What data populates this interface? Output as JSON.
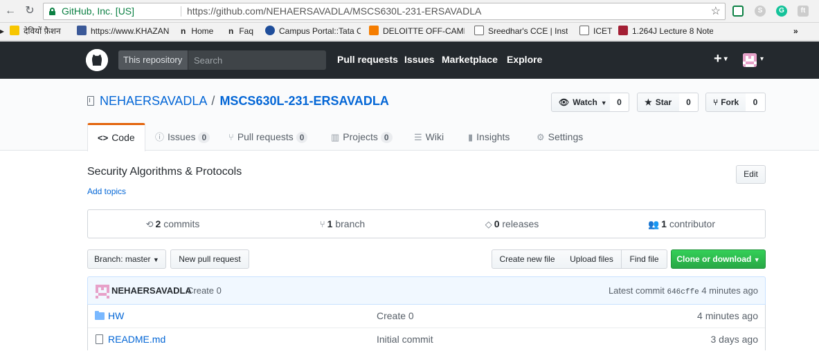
{
  "browser": {
    "ev_label": "GitHub, Inc. [US]",
    "url": "https://github.com/NEHAERSAVADLA/MSCS630L-231-ERSAVADLA",
    "back_icon": "back-arrow-icon",
    "reload_icon": "reload-icon",
    "bookmark_star_icon": "star-icon"
  },
  "bookmarks": [
    {
      "label": "देवियों फ़ैशन",
      "icon": "flipkart-icon",
      "color": "#f7c600"
    },
    {
      "label": "https://www.KHAZAN",
      "icon": "facebook-icon",
      "color": "#3b5998"
    },
    {
      "label": "Home",
      "icon": "n-icon",
      "color": "#444"
    },
    {
      "label": "Faq",
      "icon": "n-icon",
      "color": "#444"
    },
    {
      "label": "Campus Portal::Tata C",
      "icon": "tata-icon",
      "color": "#1f4e9b"
    },
    {
      "label": "DELOITTE OFF-CAMP",
      "icon": "blogger-icon",
      "color": "#f57d00"
    },
    {
      "label": "Sreedhar's CCE | Insti",
      "icon": "page-icon",
      "color": "#fff"
    },
    {
      "label": "ICET",
      "icon": "page-icon",
      "color": "#fff"
    },
    {
      "label": "1.264J Lecture 8 Note",
      "icon": "mit-icon",
      "color": "#a31f34"
    }
  ],
  "header": {
    "scope": "This repository",
    "search_placeholder": "Search",
    "nav": [
      "Pull requests",
      "Issues",
      "Marketplace",
      "Explore"
    ],
    "plus": "+"
  },
  "repo": {
    "owner": "NEHAERSAVADLA",
    "separator": "/",
    "name": "MSCS630L-231-ERSAVADLA",
    "watch_label": "Watch",
    "watch_count": "0",
    "star_label": "Star",
    "star_count": "0",
    "fork_label": "Fork",
    "fork_count": "0"
  },
  "tabs": [
    {
      "label": "Code",
      "icon": "<>",
      "count": null
    },
    {
      "label": "Issues",
      "icon": "ⓘ",
      "count": "0"
    },
    {
      "label": "Pull requests",
      "icon": "⑂",
      "count": "0"
    },
    {
      "label": "Projects",
      "icon": "▥",
      "count": "0"
    },
    {
      "label": "Wiki",
      "icon": "☰",
      "count": null
    },
    {
      "label": "Insights",
      "icon": "▮",
      "count": null
    },
    {
      "label": "Settings",
      "icon": "⚙",
      "count": null
    }
  ],
  "about": {
    "description": "Security Algorithms & Protocols",
    "add_topics": "Add topics",
    "edit": "Edit"
  },
  "summary": {
    "commits_num": "2",
    "commits_label": "commits",
    "branch_num": "1",
    "branch_label": "branch",
    "releases_num": "0",
    "releases_label": "releases",
    "contributor_num": "1",
    "contributor_label": "contributor"
  },
  "file_nav": {
    "branch_label": "Branch: master",
    "new_pr": "New pull request",
    "create_file": "Create new file",
    "upload_files": "Upload files",
    "find_file": "Find file",
    "clone": "Clone or download"
  },
  "latest_commit": {
    "author": "NEHAERSAVADLA",
    "message": "Create 0",
    "prefix": "Latest commit",
    "sha": "646cffe",
    "age": "4 minutes ago"
  },
  "files": [
    {
      "name": "HW",
      "type": "folder",
      "message": "Create 0",
      "age": "4 minutes ago"
    },
    {
      "name": "README.md",
      "type": "file",
      "message": "Initial commit",
      "age": "3 days ago"
    }
  ]
}
